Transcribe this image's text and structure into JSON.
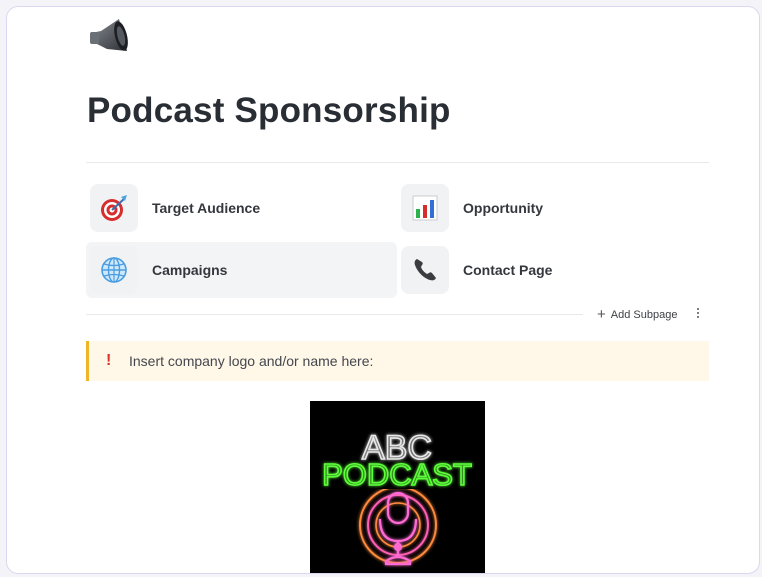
{
  "page": {
    "icon": "speaker-icon",
    "title": "Podcast Sponsorship"
  },
  "subpages": [
    {
      "label": "Target Audience",
      "icon": "target-dart-icon"
    },
    {
      "label": "Opportunity",
      "icon": "bar-chart-icon"
    },
    {
      "label": "Campaigns",
      "icon": "globe-icon"
    },
    {
      "label": "Contact Page",
      "icon": "telephone-icon"
    }
  ],
  "toolbar": {
    "add_subpage_label": "Add Subpage",
    "more_icon": "vertical-dots-icon"
  },
  "callout": {
    "icon": "exclamation-icon",
    "text": "Insert company logo and/or name here:"
  },
  "logo_image": {
    "line1": "ABC",
    "line2": "PODCAST",
    "colors": {
      "line1": "#e8e8e8",
      "line2": "#5dff3a",
      "mic": "#ff6ad5",
      "rings": "#ff9a3c"
    }
  },
  "colors": {
    "accent_callout": "#f0b429",
    "callout_bg": "#fff7e8",
    "bang": "#d9352b"
  }
}
